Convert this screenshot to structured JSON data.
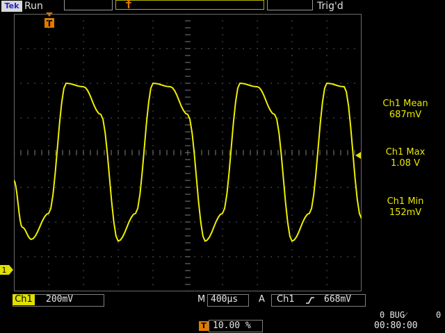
{
  "top": {
    "logo": "Tek",
    "acq_state": "Run",
    "trigger_status": "Trig'd"
  },
  "measurements": [
    {
      "label": "Ch1 Mean",
      "value": "687mV"
    },
    {
      "label": "Ch1 Max",
      "value": "1.08 V"
    },
    {
      "label": "Ch1 Min",
      "value": "152mV"
    }
  ],
  "bottom": {
    "channel": "Ch1",
    "volts_div": "200mV",
    "timebase_prefix": "M",
    "timebase": "400µs",
    "trigger_prefix": "A",
    "trigger_source": "Ch1",
    "trigger_level": "668mV",
    "trigger_position": "10.00 %",
    "trigger_position_icon": "T",
    "bug_left": "0 BUG⁄",
    "bug_right": "0",
    "clock": "00:80:00"
  },
  "markers": {
    "channel_marker": "1",
    "trigger_marker": "T"
  },
  "colors": {
    "trace": "#f0f000",
    "channel": "#e0e000",
    "trigger_marker": "#e07a00"
  },
  "chart_data": {
    "type": "line",
    "series": [
      {
        "x": [
          0,
          0.12,
          0.25,
          0.5,
          0.75,
          1.0,
          1.25,
          1.5,
          1.75,
          2.0,
          2.25,
          2.5,
          2.75,
          3.0,
          3.25,
          3.5,
          3.75,
          4.0,
          4.25,
          4.5,
          4.75,
          5.0
        ],
        "values": [
          0.52,
          0.25,
          0.18,
          0.33,
          1.08,
          1.06,
          0.9,
          0.17,
          0.33,
          1.08,
          1.06,
          0.9,
          0.17,
          0.33,
          1.08,
          1.06,
          0.9,
          0.17,
          0.33,
          1.08,
          1.06,
          0.3
        ]
      }
    ]
  }
}
